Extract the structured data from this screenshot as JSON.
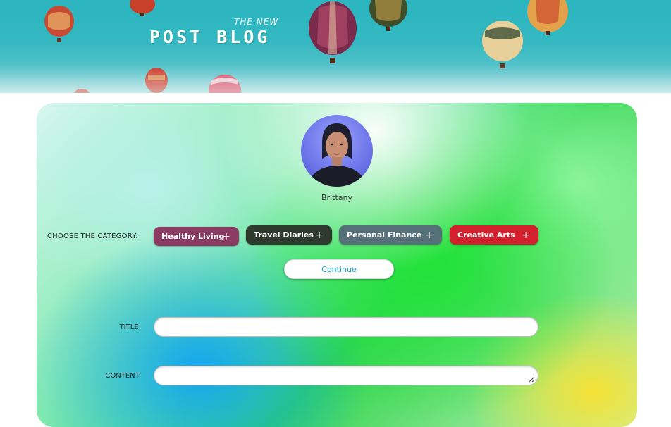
{
  "header": {
    "kicker": "THE NEW",
    "title": "POST BLOG"
  },
  "profile": {
    "name": "Brittany"
  },
  "category": {
    "label": "CHOOSE THE CATEGORY:",
    "options": [
      {
        "label": "Healthy Living",
        "color": "#8a3b62"
      },
      {
        "label": "Travel Diaries",
        "color": "#2f3a2e"
      },
      {
        "label": "Personal Finance",
        "color": "#56707a"
      },
      {
        "label": "Creative Arts",
        "color": "#d2202c"
      }
    ],
    "add_icon": "plus-icon"
  },
  "continue_label": "Continue",
  "form": {
    "title_label": "TITLE:",
    "title_value": "",
    "content_label": "CONTENT:",
    "content_value": ""
  }
}
